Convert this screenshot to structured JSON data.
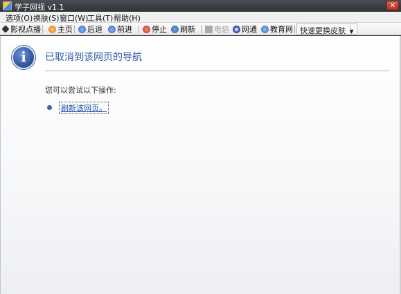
{
  "window": {
    "title": "学子网视 v1.1",
    "close_glyph": "✕"
  },
  "menu": [
    "选项(O)",
    "换肤(S)",
    "窗口(W)",
    "工具(T)",
    "帮助(H)"
  ],
  "toolbar": {
    "movies": "影视点播",
    "home": "主页",
    "back": "后退",
    "forward": "前进",
    "stop": "停止",
    "refresh": "刷新",
    "telecom": "电信",
    "netcom": "网通",
    "edu": "教育网",
    "skin": "快速更换皮肤",
    "skin_arrow": "▼"
  },
  "page": {
    "info_glyph": "i",
    "title": "已取消到该网页的导航",
    "subtitle": "您可以尝试以下操作:",
    "refresh_link": "刷新该网页。"
  },
  "colors": {
    "title": "#2c5aa8",
    "link": "#1f4fb0",
    "accent": "#3b64b8"
  }
}
